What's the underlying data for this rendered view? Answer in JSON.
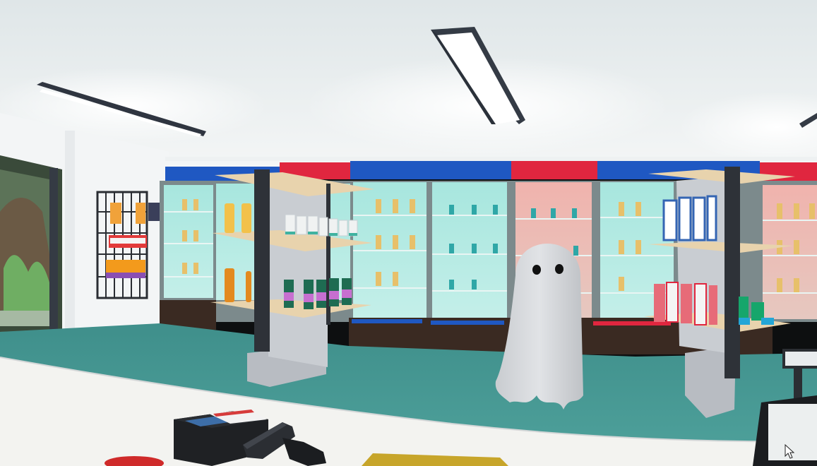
{
  "scene": {
    "type": "3D store interior viewed from checkout counter",
    "colors": {
      "ceiling": "#e9eef0",
      "back_wall_trim_blue": "#1f58c2",
      "back_wall_trim_red": "#e0263f",
      "fridge_glass": "#9fe0d8",
      "floor": "#4a9a95",
      "counter": "#f3f3f0",
      "ghost": "#d8dadd",
      "shelf_post": "#2e3238",
      "shelf_wood": "#e8d3ad"
    }
  },
  "player_view": {
    "held_tools": [
      "barcode-scanner",
      "card-reader"
    ],
    "cursor": "arrow-cursor"
  }
}
